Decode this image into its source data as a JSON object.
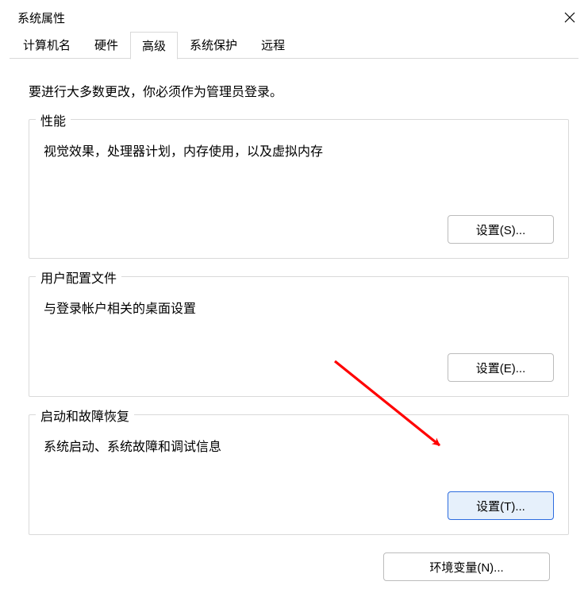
{
  "window": {
    "title": "系统属性"
  },
  "tabs": [
    {
      "label": "计算机名"
    },
    {
      "label": "硬件"
    },
    {
      "label": "高级"
    },
    {
      "label": "系统保护"
    },
    {
      "label": "远程"
    }
  ],
  "advanced": {
    "intro": "要进行大多数更改，你必须作为管理员登录。",
    "performance": {
      "title": "性能",
      "desc": "视觉效果，处理器计划，内存使用，以及虚拟内存",
      "button": "设置(S)..."
    },
    "userprofile": {
      "title": "用户配置文件",
      "desc": "与登录帐户相关的桌面设置",
      "button": "设置(E)..."
    },
    "startup": {
      "title": "启动和故障恢复",
      "desc": "系统启动、系统故障和调试信息",
      "button": "设置(T)..."
    },
    "env_button": "环境变量(N)..."
  },
  "annotation": {
    "arrow_color": "#ff0000"
  }
}
